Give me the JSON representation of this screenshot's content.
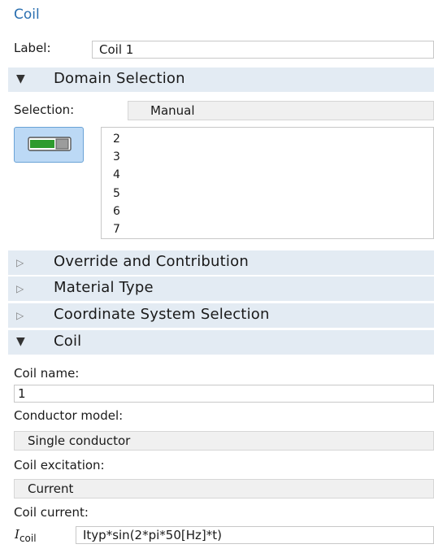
{
  "header": {
    "title": "Coil"
  },
  "label_field": {
    "label": "Label:",
    "value": "Coil 1"
  },
  "domain_selection": {
    "title": "Domain Selection",
    "selection_label": "Selection:",
    "selection_value": "Manual",
    "domains": [
      "2",
      "3",
      "4",
      "5",
      "6",
      "7"
    ]
  },
  "collapsed_sections": [
    {
      "title": "Override and Contribution"
    },
    {
      "title": "Material Type"
    },
    {
      "title": "Coordinate System Selection"
    }
  ],
  "coil_section": {
    "title": "Coil",
    "coil_name_label": "Coil name:",
    "coil_name_value": "1",
    "conductor_model_label": "Conductor model:",
    "conductor_model_value": "Single conductor",
    "coil_excitation_label": "Coil excitation:",
    "coil_excitation_value": "Current",
    "coil_current_label": "Coil current:",
    "current_symbol": "I",
    "current_subscript": "coil",
    "current_expression": "Ityp*sin(2*pi*50[Hz]*t)"
  },
  "icons": {
    "expanded": "triangle-down-icon",
    "collapsed": "triangle-right-icon",
    "selection": "active-toggle-icon"
  },
  "colors": {
    "title": "#2a6fb0",
    "section_bg": "#e3ebf3",
    "toggle_green": "#2e9b2e"
  }
}
